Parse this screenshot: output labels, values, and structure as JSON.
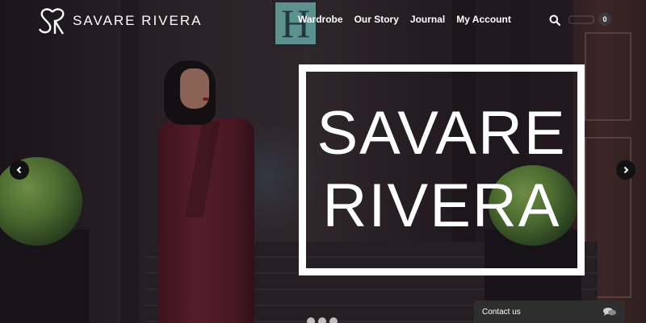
{
  "brand": {
    "logo_text": "SAVARE RIVERA",
    "logo_mark": "SR"
  },
  "nav": {
    "items": [
      {
        "label": "Wardrobe"
      },
      {
        "label": "Our Story"
      },
      {
        "label": "Journal"
      },
      {
        "label": "My Account"
      }
    ]
  },
  "header": {
    "cart_count": "0",
    "icons": [
      "search-icon",
      "cart-icon"
    ]
  },
  "hero": {
    "headline_line1": "SAVARE",
    "headline_line2": "RIVERA",
    "sign_letter": "H",
    "slides_count": 3,
    "arrows": [
      "chevron-left-icon",
      "chevron-right-icon"
    ]
  },
  "contact_widget": {
    "label": "Contact us",
    "icon": "chat-bubbles-icon"
  },
  "colors": {
    "overlay_text": "#ffffff",
    "coat": "#6e2232",
    "sign": "#79c4bd"
  }
}
